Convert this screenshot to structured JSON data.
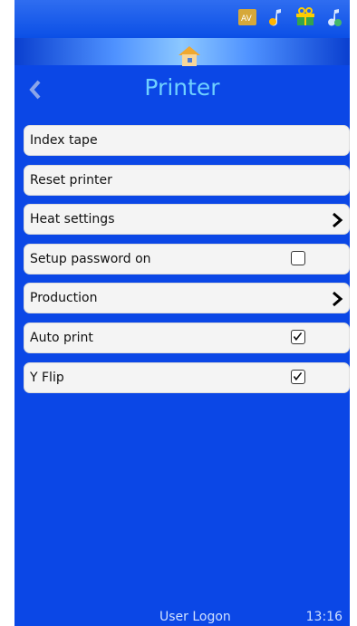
{
  "header": {
    "title": "Printer",
    "home_icon": "home-icon",
    "back_icon": "chevron-left-icon"
  },
  "top_icons": [
    "language-icon",
    "music-note-icon",
    "gift-icon",
    "music-note-icon"
  ],
  "menu": {
    "items": [
      {
        "label": "Index tape",
        "control": "none"
      },
      {
        "label": "Reset printer",
        "control": "none"
      },
      {
        "label": "Heat settings",
        "control": "chevron"
      },
      {
        "label": "Setup password on",
        "control": "checkbox",
        "checked": false
      },
      {
        "label": "Production",
        "control": "chevron"
      },
      {
        "label": "Auto print",
        "control": "checkbox",
        "checked": true
      },
      {
        "label": "Y Flip",
        "control": "checkbox",
        "checked": true
      }
    ]
  },
  "footer": {
    "logon_label": "User Logon",
    "time": "13:16"
  },
  "colors": {
    "background": "#0b47e6",
    "title": "#6fd0ff",
    "item_bg": "#f4f4f4"
  }
}
